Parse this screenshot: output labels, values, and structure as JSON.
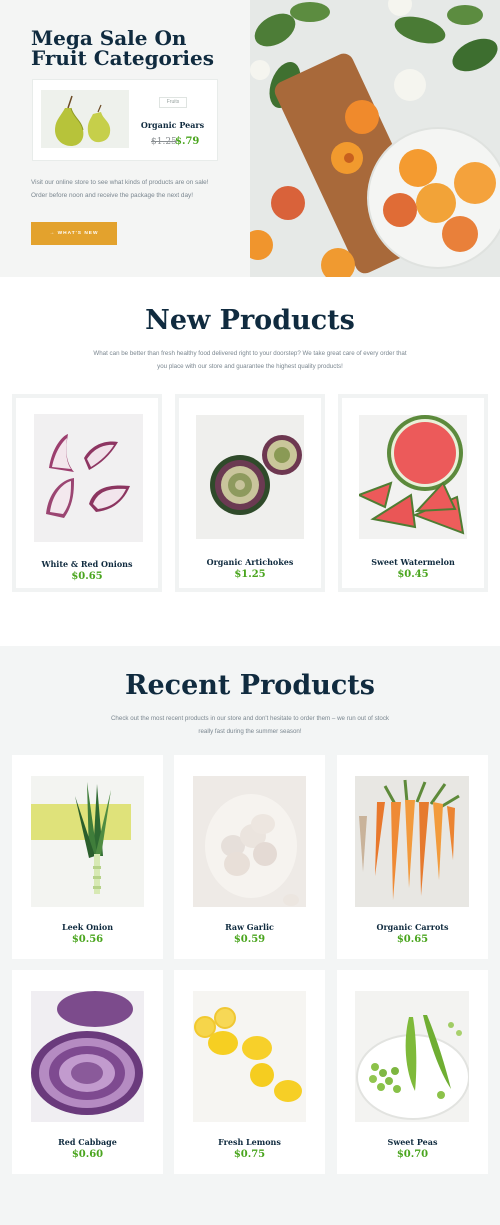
{
  "hero": {
    "title": "Mega Sale On Fruit Categories",
    "promo": {
      "tag": "Fruits",
      "name": "Organic Pears",
      "old_price": "$1.25",
      "new_price": "$.79",
      "image_icon": "pear-photo"
    },
    "description": "Visit our online store to see what kinds of products are on sale! Order before noon and receive the package the next day!",
    "button_label": "→ WHAT'S NEW",
    "image_icon": "apricots-bowl-photo"
  },
  "new_products": {
    "title": "New Products",
    "description": "What can be better than fresh healthy food delivered right to your doorstep? We take great care of every order that you place with our store and guarantee the highest quality products!",
    "items": [
      {
        "name": "White & Red Onions",
        "price": "$0.65",
        "image_icon": "onion-photo"
      },
      {
        "name": "Organic Artichokes",
        "price": "$1.25",
        "image_icon": "artichoke-photo"
      },
      {
        "name": "Sweet Watermelon",
        "price": "$0.45",
        "image_icon": "watermelon-photo"
      }
    ]
  },
  "recent_products": {
    "title": "Recent Products",
    "description": "Check out the most recent products in our store and don't hesitate to order them – we run out of stock really fast during the summer season!",
    "items": [
      {
        "name": "Leek Onion",
        "price": "$0.56",
        "image_icon": "leek-photo"
      },
      {
        "name": "Raw Garlic",
        "price": "$0.59",
        "image_icon": "garlic-photo"
      },
      {
        "name": "Organic Carrots",
        "price": "$0.65",
        "image_icon": "carrot-photo"
      },
      {
        "name": "Red Cabbage",
        "price": "$0.60",
        "image_icon": "cabbage-photo"
      },
      {
        "name": "Fresh Lemons",
        "price": "$0.75",
        "image_icon": "lemon-photo"
      },
      {
        "name": "Sweet Peas",
        "price": "$0.70",
        "image_icon": "peas-photo"
      }
    ]
  },
  "colors": {
    "heading": "#102b3f",
    "price_green": "#4aa51e",
    "accent_button": "#e3a22d",
    "section_bg": "#f3f5f5"
  }
}
